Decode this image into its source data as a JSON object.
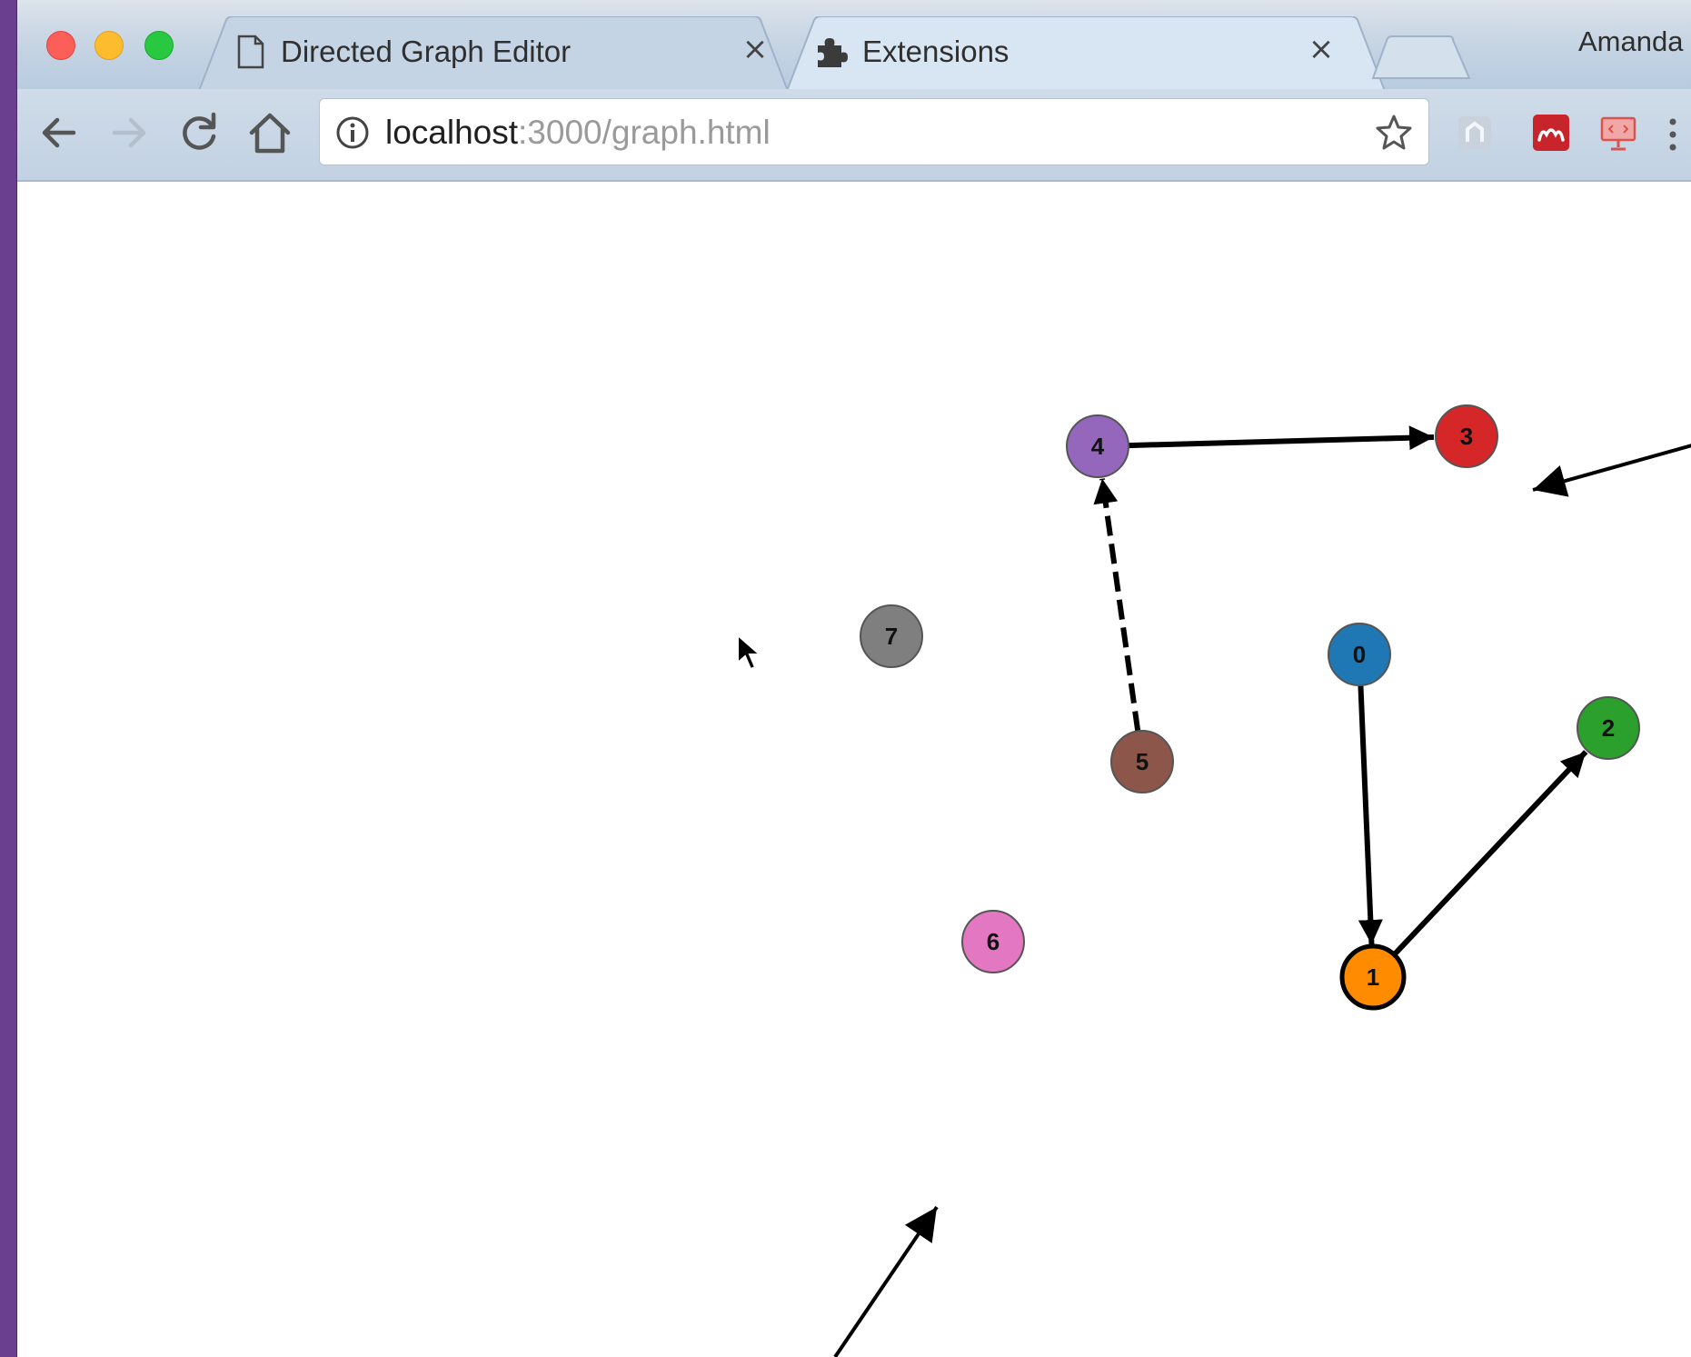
{
  "tabs": [
    {
      "title": "Directed Graph Editor",
      "icon": "page-icon",
      "close": "×"
    },
    {
      "title": "Extensions",
      "icon": "puzzle-icon",
      "close": "×"
    }
  ],
  "profile": {
    "name": "Amanda"
  },
  "address_bar": {
    "host": "localhost",
    "path": ":3000/graph.html"
  },
  "toolbar_icons": [
    "back-arrow-icon",
    "forward-arrow-icon",
    "reload-icon",
    "home-icon",
    "info-icon",
    "bookmark-star-icon",
    "extension-icon",
    "mendeley-icon",
    "presentation-icon",
    "menu-dots-icon"
  ],
  "graph": {
    "nodes": [
      {
        "id": "0",
        "color": "#1f77b4"
      },
      {
        "id": "1",
        "color": "#ff8c00",
        "selected": true
      },
      {
        "id": "2",
        "color": "#2ca02c"
      },
      {
        "id": "3",
        "color": "#d62728"
      },
      {
        "id": "4",
        "color": "#9467bd"
      },
      {
        "id": "5",
        "color": "#8c564b"
      },
      {
        "id": "6",
        "color": "#e377c2"
      },
      {
        "id": "7",
        "color": "#7f7f7f"
      }
    ],
    "edges": [
      {
        "source": "4",
        "target": "3",
        "style": "solid"
      },
      {
        "source": "5",
        "target": "4",
        "style": "dashed"
      },
      {
        "source": "0",
        "target": "1",
        "style": "solid"
      },
      {
        "source": "1",
        "target": "2",
        "style": "solid"
      }
    ]
  }
}
